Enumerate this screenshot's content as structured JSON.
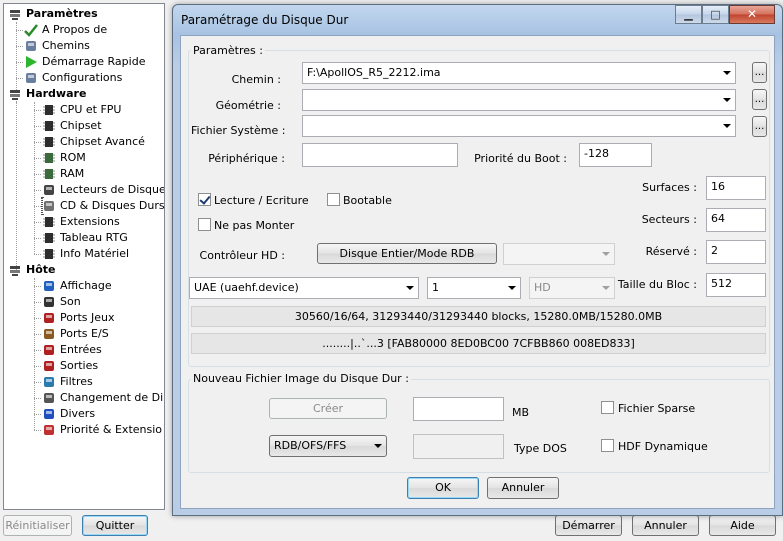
{
  "tree": {
    "items": [
      {
        "label": "Paramètres",
        "bold": true,
        "icon": "gear-icon"
      },
      {
        "label": "A Propos de",
        "icon": "checkmark-icon"
      },
      {
        "label": "Chemins",
        "icon": "folder-list-icon"
      },
      {
        "label": "Démarrage Rapide",
        "icon": "play-arrow-icon"
      },
      {
        "label": "Configurations",
        "icon": "config-list-icon"
      },
      {
        "label": "Hardware",
        "bold": true,
        "icon": "gear-icon"
      },
      {
        "label": "CPU et FPU",
        "icon": "chip-icon"
      },
      {
        "label": "Chipset",
        "icon": "chip-icon"
      },
      {
        "label": "Chipset Avancé",
        "icon": "chip-icon"
      },
      {
        "label": "ROM",
        "icon": "memory-icon"
      },
      {
        "label": "RAM",
        "icon": "memory-icon"
      },
      {
        "label": "Lecteurs de Disque",
        "icon": "floppy-drive-icon"
      },
      {
        "label": "CD & Disques Durs",
        "icon": "hard-disk-icon"
      },
      {
        "label": "Extensions",
        "icon": "chip-icon"
      },
      {
        "label": "Tableau RTG",
        "icon": "chip-icon"
      },
      {
        "label": "Info Matériel",
        "icon": "chip-icon"
      },
      {
        "label": "Hôte",
        "bold": true,
        "icon": "gear-icon"
      },
      {
        "label": "Affichage",
        "icon": "display-icon"
      },
      {
        "label": "Son",
        "icon": "speaker-icon"
      },
      {
        "label": "Ports Jeux",
        "icon": "joystick-icon"
      },
      {
        "label": "Ports E/S",
        "icon": "port-icon"
      },
      {
        "label": "Entrées",
        "icon": "joystick-icon"
      },
      {
        "label": "Sorties",
        "icon": "joystick-icon"
      },
      {
        "label": "Filtres",
        "icon": "filter-icon"
      },
      {
        "label": "Changement de Di",
        "icon": "swap-icon"
      },
      {
        "label": "Divers",
        "icon": "misc-icon"
      },
      {
        "label": "Priorité & Extensio",
        "icon": "priority-icon"
      }
    ]
  },
  "main_buttons": {
    "reset": "Réinitialiser",
    "quit": "Quitter",
    "start": "Démarrer",
    "cancel": "Annuler",
    "help": "Aide"
  },
  "dialog": {
    "title": "Paramétrage du Disque Dur",
    "params_group": "Paramètres :",
    "path_label": "Chemin :",
    "path_value": "F:\\ApollOS_R5_2212.ima",
    "geometry_label": "Géométrie :",
    "geometry_value": "",
    "filesystem_label": "Fichier Système :",
    "filesystem_value": "",
    "browse": "...",
    "device_label": "Périphérique :",
    "device_value": "",
    "boot_priority_label": "Priorité du Boot :",
    "boot_priority_value": "-128",
    "read_write_label": "Lecture / Ecriture",
    "read_write_checked": true,
    "bootable_label": "Bootable",
    "bootable_checked": false,
    "no_mount_label": "Ne pas Monter",
    "no_mount_checked": false,
    "surfaces_label": "Surfaces :",
    "surfaces_value": "16",
    "sectors_label": "Secteurs :",
    "sectors_value": "64",
    "reserved_label": "Réservé :",
    "reserved_value": "2",
    "block_size_label": "Taille du Bloc :",
    "block_size_value": "512",
    "controller_label": "Contrôleur HD :",
    "controller_mode_button": "Disque Entier/Mode RDB",
    "controller_select": "",
    "controller_driver": "UAE (uaehf.device)",
    "controller_unit": "1",
    "controller_type": "HD",
    "info_geometry": "30560/16/64, 31293440/31293440 blocks, 15280.0MB/15280.0MB",
    "info_hex": "........|..`...3 [FAB80000 8ED0BC00 7CFBB860 008ED833]",
    "new_image_group": "Nouveau Fichier Image du Disque Dur :",
    "create_button": "Créer",
    "size_value": "",
    "size_unit": "MB",
    "sparse_label": "Fichier Sparse",
    "sparse_checked": false,
    "fs_type_value": "RDB/OFS/FFS",
    "dos_type_value": "",
    "dos_type_label": "Type DOS",
    "dynamic_hdf_label": "HDF Dynamique",
    "dynamic_hdf_checked": false,
    "ok": "OK",
    "cancel": "Annuler"
  }
}
